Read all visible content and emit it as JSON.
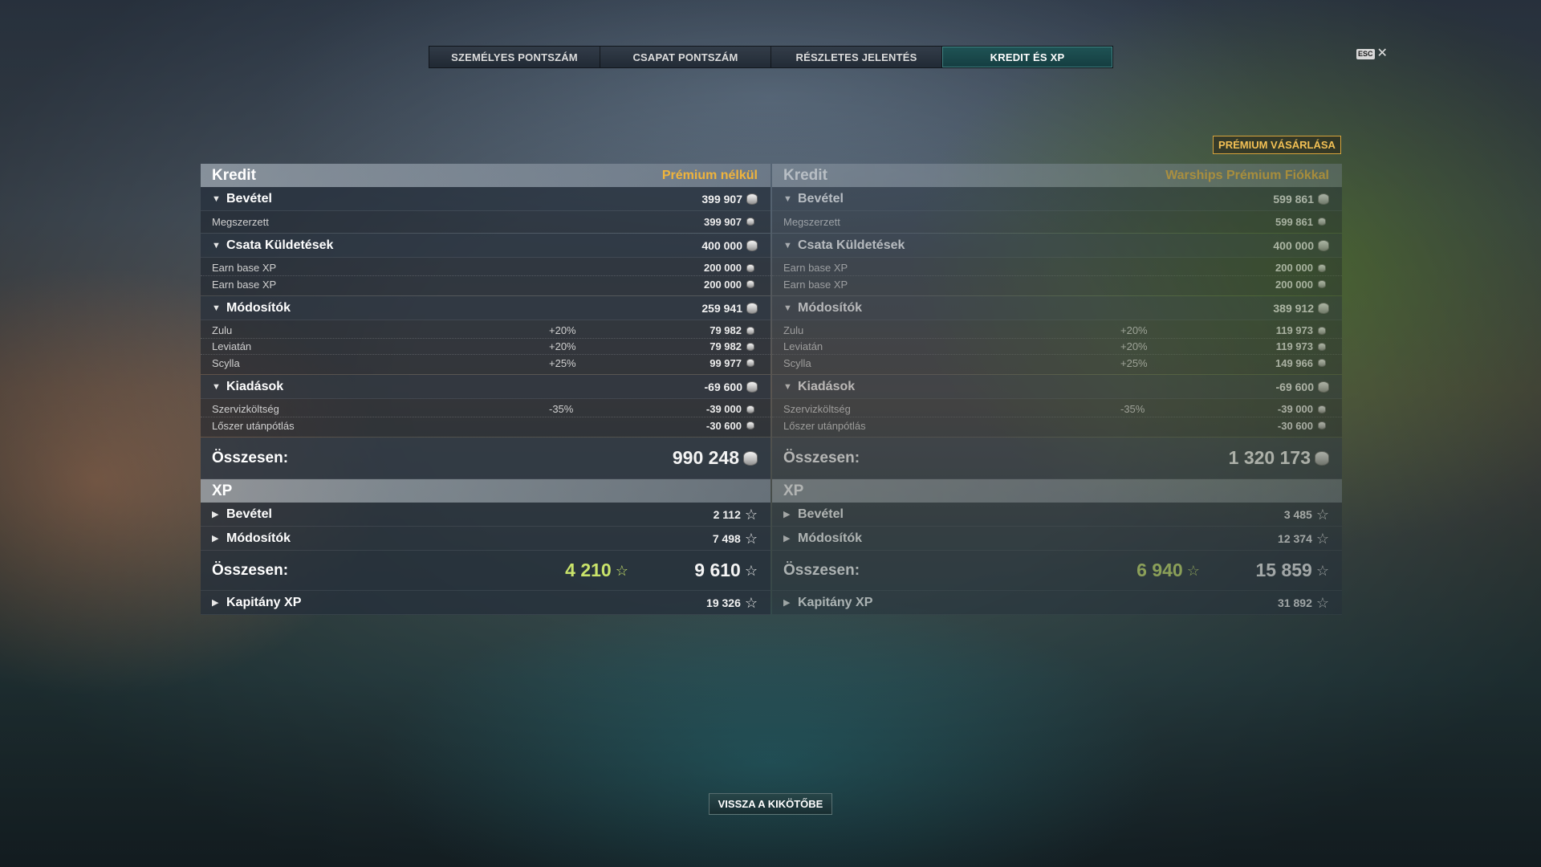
{
  "tabs": [
    {
      "label": "SZEMÉLYES PONTSZÁM",
      "active": false
    },
    {
      "label": "CSAPAT PONTSZÁM",
      "active": false
    },
    {
      "label": "RÉSZLETES JELENTÉS",
      "active": false
    },
    {
      "label": "KREDIT ÉS XP",
      "active": true
    }
  ],
  "esc": {
    "key": "ESC",
    "close": "✕"
  },
  "premium_button": "PRÉMIUM VÁSÁRLÁSA",
  "back_button": "VISSZA A KIKÖTŐBE",
  "panels": {
    "left": {
      "credit_title": "Kredit",
      "credit_subtitle": "Prémium nélkül",
      "income": {
        "label": "Bevétel",
        "value": "399 907",
        "rows": [
          {
            "label": "Megszerzett",
            "value": "399 907"
          }
        ]
      },
      "missions": {
        "label": "Csata Küldetések",
        "value": "400 000",
        "rows": [
          {
            "label": "Earn base XP",
            "value": "200 000"
          },
          {
            "label": "Earn base XP",
            "value": "200 000"
          }
        ]
      },
      "modifiers": {
        "label": "Módosítók",
        "value": "259 941",
        "rows": [
          {
            "label": "Zulu",
            "pct": "+20%",
            "value": "79 982"
          },
          {
            "label": "Leviatán",
            "pct": "+20%",
            "value": "79 982"
          },
          {
            "label": "Scylla",
            "pct": "+25%",
            "value": "99 977"
          }
        ]
      },
      "expenses": {
        "label": "Kiadások",
        "value": "-69 600",
        "rows": [
          {
            "label": "Szervizköltség",
            "pct": "-35%",
            "value": "-39 000"
          },
          {
            "label": "Lőszer utánpótlás",
            "pct": "",
            "value": "-30 600"
          }
        ]
      },
      "total": {
        "label": "Összesen:",
        "value": "990 248"
      },
      "xp_title": "XP",
      "xp_income": {
        "label": "Bevétel",
        "value": "2 112"
      },
      "xp_modifiers": {
        "label": "Módosítók",
        "value": "7 498"
      },
      "xp_total": {
        "label": "Összesen:",
        "green": "4 210",
        "value": "9 610"
      },
      "captain_xp": {
        "label": "Kapitány XP",
        "value": "19 326"
      }
    },
    "right": {
      "credit_title": "Kredit",
      "credit_subtitle": "Warships Prémium Fiókkal",
      "income": {
        "label": "Bevétel",
        "value": "599 861",
        "rows": [
          {
            "label": "Megszerzett",
            "value": "599 861"
          }
        ]
      },
      "missions": {
        "label": "Csata Küldetések",
        "value": "400 000",
        "rows": [
          {
            "label": "Earn base XP",
            "value": "200 000"
          },
          {
            "label": "Earn base XP",
            "value": "200 000"
          }
        ]
      },
      "modifiers": {
        "label": "Módosítók",
        "value": "389 912",
        "rows": [
          {
            "label": "Zulu",
            "pct": "+20%",
            "value": "119 973"
          },
          {
            "label": "Leviatán",
            "pct": "+20%",
            "value": "119 973"
          },
          {
            "label": "Scylla",
            "pct": "+25%",
            "value": "149 966"
          }
        ]
      },
      "expenses": {
        "label": "Kiadások",
        "value": "-69 600",
        "rows": [
          {
            "label": "Szervizköltség",
            "pct": "-35%",
            "value": "-39 000"
          },
          {
            "label": "Lőszer utánpótlás",
            "pct": "",
            "value": "-30 600"
          }
        ]
      },
      "total": {
        "label": "Összesen:",
        "value": "1 320 173"
      },
      "xp_title": "XP",
      "xp_income": {
        "label": "Bevétel",
        "value": "3 485"
      },
      "xp_modifiers": {
        "label": "Módosítók",
        "value": "12 374"
      },
      "xp_total": {
        "label": "Összesen:",
        "green": "6 940",
        "value": "15 859"
      },
      "captain_xp": {
        "label": "Kapitány XP",
        "value": "31 892"
      }
    }
  },
  "icons": {
    "coin": "credit-coin-icon",
    "xp": "star-icon",
    "expand": "caret-icon"
  },
  "colors": {
    "accent_gold": "#f0b43c",
    "active_tab": "#1e5a5a",
    "xp_green": "#c9e36a"
  }
}
